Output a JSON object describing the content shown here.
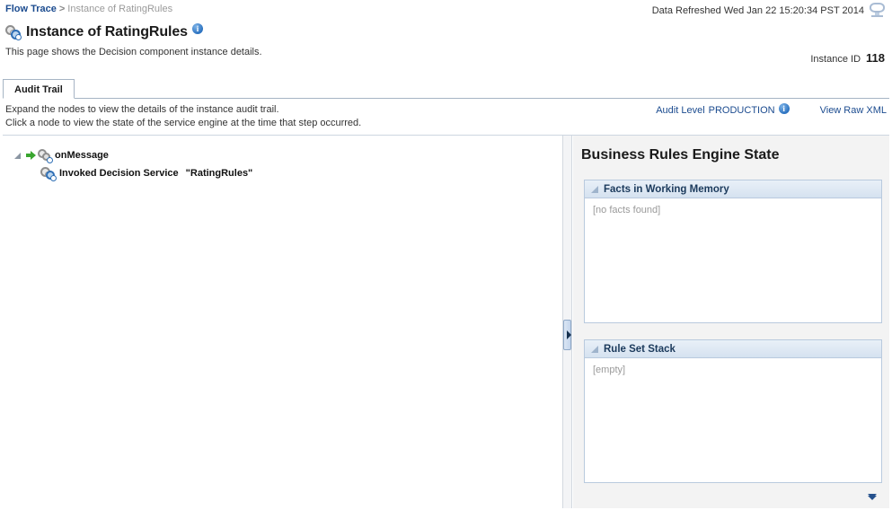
{
  "breadcrumb": {
    "root_label": "Flow Trace",
    "separator": ">",
    "current_label": "Instance of RatingRules"
  },
  "header": {
    "refresh_text": "Data Refreshed Wed Jan 22 15:20:34 PST 2014",
    "refresh_icon": "monitor-icon",
    "title": "Instance of RatingRules",
    "title_icon": "decision-component-icon",
    "title_info_icon": "i",
    "subtitle": "This page shows the Decision component instance details.",
    "instance_id_label": "Instance ID",
    "instance_id_value": "118"
  },
  "tabs": [
    {
      "label": "Audit Trail",
      "selected": true
    }
  ],
  "instructions": {
    "line1": "Expand the nodes to view the details of the instance audit trail.",
    "line2": "Click a node to view the state of the service engine at the time that step occurred."
  },
  "audit_toolbar": {
    "audit_level_label": "Audit Level",
    "audit_level_value": "PRODUCTION",
    "audit_level_info_icon": "i",
    "view_raw_xml_label": "View Raw XML"
  },
  "audit_tree": {
    "root": {
      "label": "onMessage",
      "expanded": true,
      "disclosure_icon": "triangle-expanded-icon",
      "arrow_icon": "green-arrow-icon",
      "node_icon": "gear-icon"
    },
    "child": {
      "label": "Invoked Decision Service",
      "argument": "\"RatingRules\"",
      "node_icon": "decision-service-icon"
    }
  },
  "splitter": {
    "handle_icon": "collapse-right-arrow-icon"
  },
  "engine_state": {
    "title": "Business Rules Engine State",
    "panels": [
      {
        "title": "Facts in Working Memory",
        "disclosure_icon": "triangle-expanded-icon",
        "body_text": "[no facts found]"
      },
      {
        "title": "Rule Set Stack",
        "disclosure_icon": "triangle-expanded-icon",
        "body_text": "[empty]"
      }
    ],
    "more_icon": "double-chevron-down-icon"
  },
  "colors": {
    "link": "#1b4b8f",
    "panel_header_start": "#e9f0f8",
    "panel_header_end": "#d5e2f0",
    "panel_border": "#b9cade",
    "pane_background": "#f3f3f3",
    "muted_text": "#9a9a9a"
  }
}
